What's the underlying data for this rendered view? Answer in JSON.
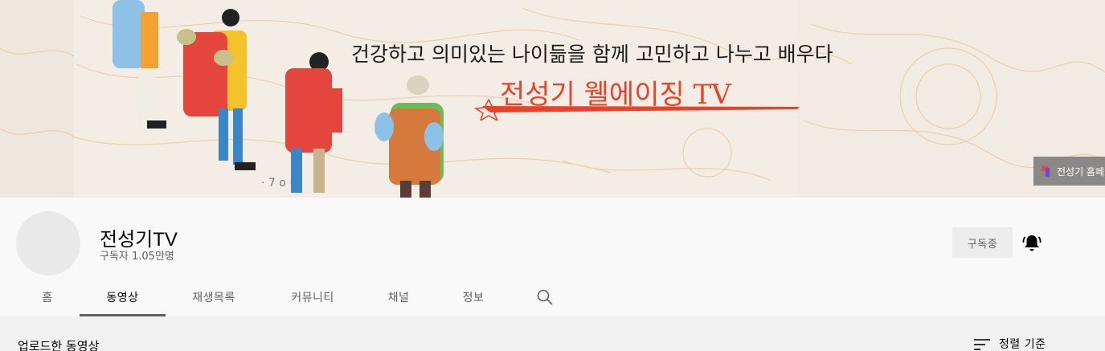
{
  "banner": {
    "tagline": "건강하고 의미있는 나이듦을 함께 고민하고 나누고 배우다",
    "brand": "전성기 웰에이징 TV",
    "homepage_link_label": "전성기 홈페"
  },
  "channel": {
    "name": "전성기TV",
    "subscribers": "구독자 1.05만명",
    "subscribe_button_label": "구독중"
  },
  "tabs": [
    {
      "label": "홈",
      "active": false
    },
    {
      "label": "동영상",
      "active": true
    },
    {
      "label": "재생목록",
      "active": false
    },
    {
      "label": "커뮤니티",
      "active": false
    },
    {
      "label": "채널",
      "active": false
    },
    {
      "label": "정보",
      "active": false
    }
  ],
  "content": {
    "section_title": "업로드한 동영상",
    "sort_label": "정렬 기준"
  },
  "icons": {
    "bell": "bell-icon",
    "search": "search-icon",
    "sort": "sort-icon"
  },
  "colors": {
    "brand_red": "#e8432a",
    "active_tab_underline": "#606060"
  }
}
